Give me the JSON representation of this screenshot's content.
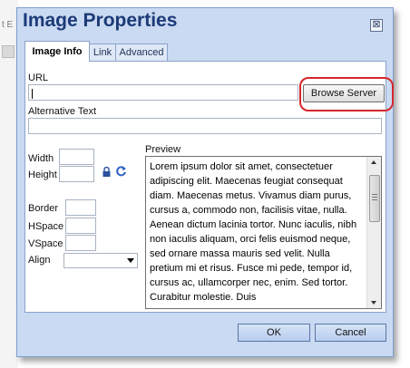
{
  "background": {
    "partial_text": "t E"
  },
  "dialog": {
    "title": "Image Properties",
    "close_glyph": "⊠",
    "tabs": [
      {
        "label": "Image Info",
        "active": true
      },
      {
        "label": "Link",
        "active": false
      },
      {
        "label": "Advanced",
        "active": false
      }
    ],
    "url": {
      "label": "URL",
      "value": ""
    },
    "browse_button": "Browse Server",
    "alt_text": {
      "label": "Alternative Text",
      "value": ""
    },
    "fields": {
      "width": {
        "label": "Width",
        "value": ""
      },
      "height": {
        "label": "Height",
        "value": ""
      },
      "border": {
        "label": "Border",
        "value": ""
      },
      "hspace": {
        "label": "HSpace",
        "value": ""
      },
      "vspace": {
        "label": "VSpace",
        "value": ""
      },
      "align": {
        "label": "Align",
        "value": ""
      }
    },
    "preview": {
      "label": "Preview",
      "text": "Lorem ipsum dolor sit amet, consectetuer adipiscing elit. Maecenas feugiat consequat diam. Maecenas metus. Vivamus diam purus, cursus a, commodo non, facilisis vitae, nulla. Aenean dictum lacinia tortor. Nunc iaculis, nibh non iaculis aliquam, orci felis euismod neque, sed ornare massa mauris sed velit. Nulla pretium mi et risus. Fusce mi pede, tempor id, cursus ac, ullamcorper nec, enim. Sed tortor. Curabitur molestie. Duis"
    },
    "ok_button": "OK",
    "cancel_button": "Cancel"
  },
  "colors": {
    "dialog_bg": "#c9daf2",
    "title_text": "#1d3a78",
    "highlight": "#d6262b"
  },
  "icons": {
    "lock": "lock-icon",
    "reset": "reset-size-icon",
    "close": "close-icon"
  }
}
